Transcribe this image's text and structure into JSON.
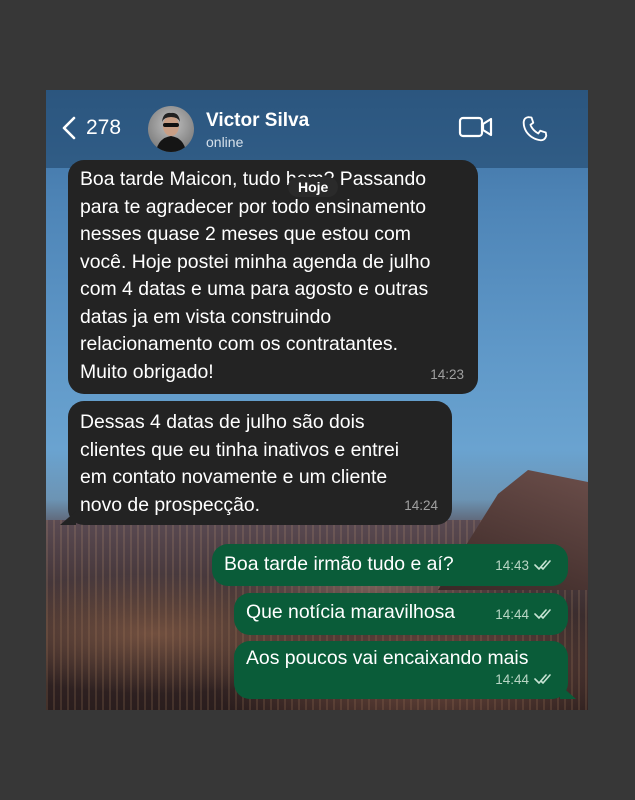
{
  "header": {
    "back_count": "278",
    "contact_name": "Victor Silva",
    "status": "online",
    "icons": [
      "chevron-left-icon",
      "video-call-icon",
      "phone-icon"
    ]
  },
  "date_divider": "Hoje",
  "messages": [
    {
      "direction": "incoming",
      "text": "Boa tarde Maicon, tudo bem? Passando\npara te agradecer por todo ensinamento\nnesses quase 2 meses que estou com\nvocê. Hoje postei minha agenda de julho\ncom 4 datas e uma para agosto e outras\ndatas ja em vista construindo\nrelacionamento com os contratantes.\nMuito obrigado!",
      "time": "14:23"
    },
    {
      "direction": "incoming",
      "text": "Dessas 4 datas de julho são dois\nclientes que eu tinha inativos e entrei\nem contato novamente e um cliente\nnovo de prospecção.",
      "time": "14:24"
    },
    {
      "direction": "outgoing",
      "text": "Boa tarde irmão tudo e aí?",
      "time": "14:43",
      "status": "read"
    },
    {
      "direction": "outgoing",
      "text": "Que notícia maravilhosa",
      "time": "14:44",
      "status": "read"
    },
    {
      "direction": "outgoing",
      "text": "Aos poucos vai encaixando mais",
      "time": "14:44",
      "status": "read"
    }
  ],
  "colors": {
    "incoming_bubble": "#232323",
    "outgoing_bubble": "#0a5c39",
    "page_background": "#373737"
  }
}
